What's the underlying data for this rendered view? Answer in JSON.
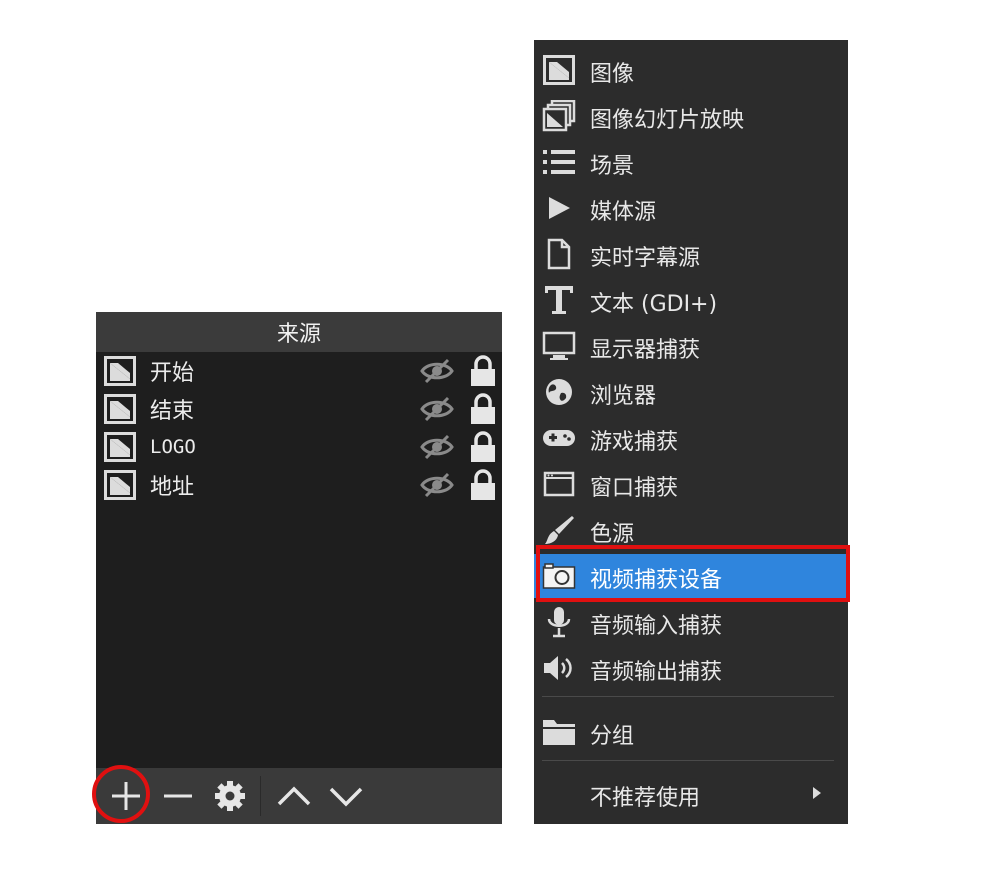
{
  "sources_dock": {
    "title": "来源",
    "items": [
      {
        "label": "开始",
        "icon": "image-icon"
      },
      {
        "label": "结束",
        "icon": "image-icon"
      },
      {
        "label": "LOGO",
        "icon": "image-icon"
      },
      {
        "label": "地址",
        "icon": "image-icon"
      }
    ],
    "toolbar": [
      "add-icon",
      "remove-icon",
      "gear-icon",
      "move-up-icon",
      "move-down-icon"
    ]
  },
  "add_source_menu": {
    "items": [
      {
        "label": "图像",
        "icon": "image-icon"
      },
      {
        "label": "图像幻灯片放映",
        "icon": "slideshow-icon"
      },
      {
        "label": "场景",
        "icon": "list-icon"
      },
      {
        "label": "媒体源",
        "icon": "play-icon"
      },
      {
        "label": "实时字幕源",
        "icon": "document-icon"
      },
      {
        "label": "文本 (GDI+)",
        "icon": "text-icon"
      },
      {
        "label": "显示器捕获",
        "icon": "monitor-icon"
      },
      {
        "label": "浏览器",
        "icon": "globe-icon"
      },
      {
        "label": "游戏捕获",
        "icon": "gamepad-icon"
      },
      {
        "label": "窗口捕获",
        "icon": "window-icon"
      },
      {
        "label": "色源",
        "icon": "brush-icon"
      },
      {
        "label": "视频捕获设备",
        "icon": "camera-icon",
        "selected": true
      },
      {
        "label": "音频输入捕获",
        "icon": "microphone-icon"
      },
      {
        "label": "音频输出捕获",
        "icon": "speaker-icon"
      }
    ],
    "group": {
      "label": "分组",
      "icon": "folder-icon"
    },
    "deprecated": {
      "label": "不推荐使用",
      "icon": "chevron-right-icon"
    }
  },
  "colors": {
    "menu_bg": "#2c2c2c",
    "selected": "#2f85dd",
    "annotation": "#e01010",
    "dock_bg": "#1e1e1e"
  }
}
